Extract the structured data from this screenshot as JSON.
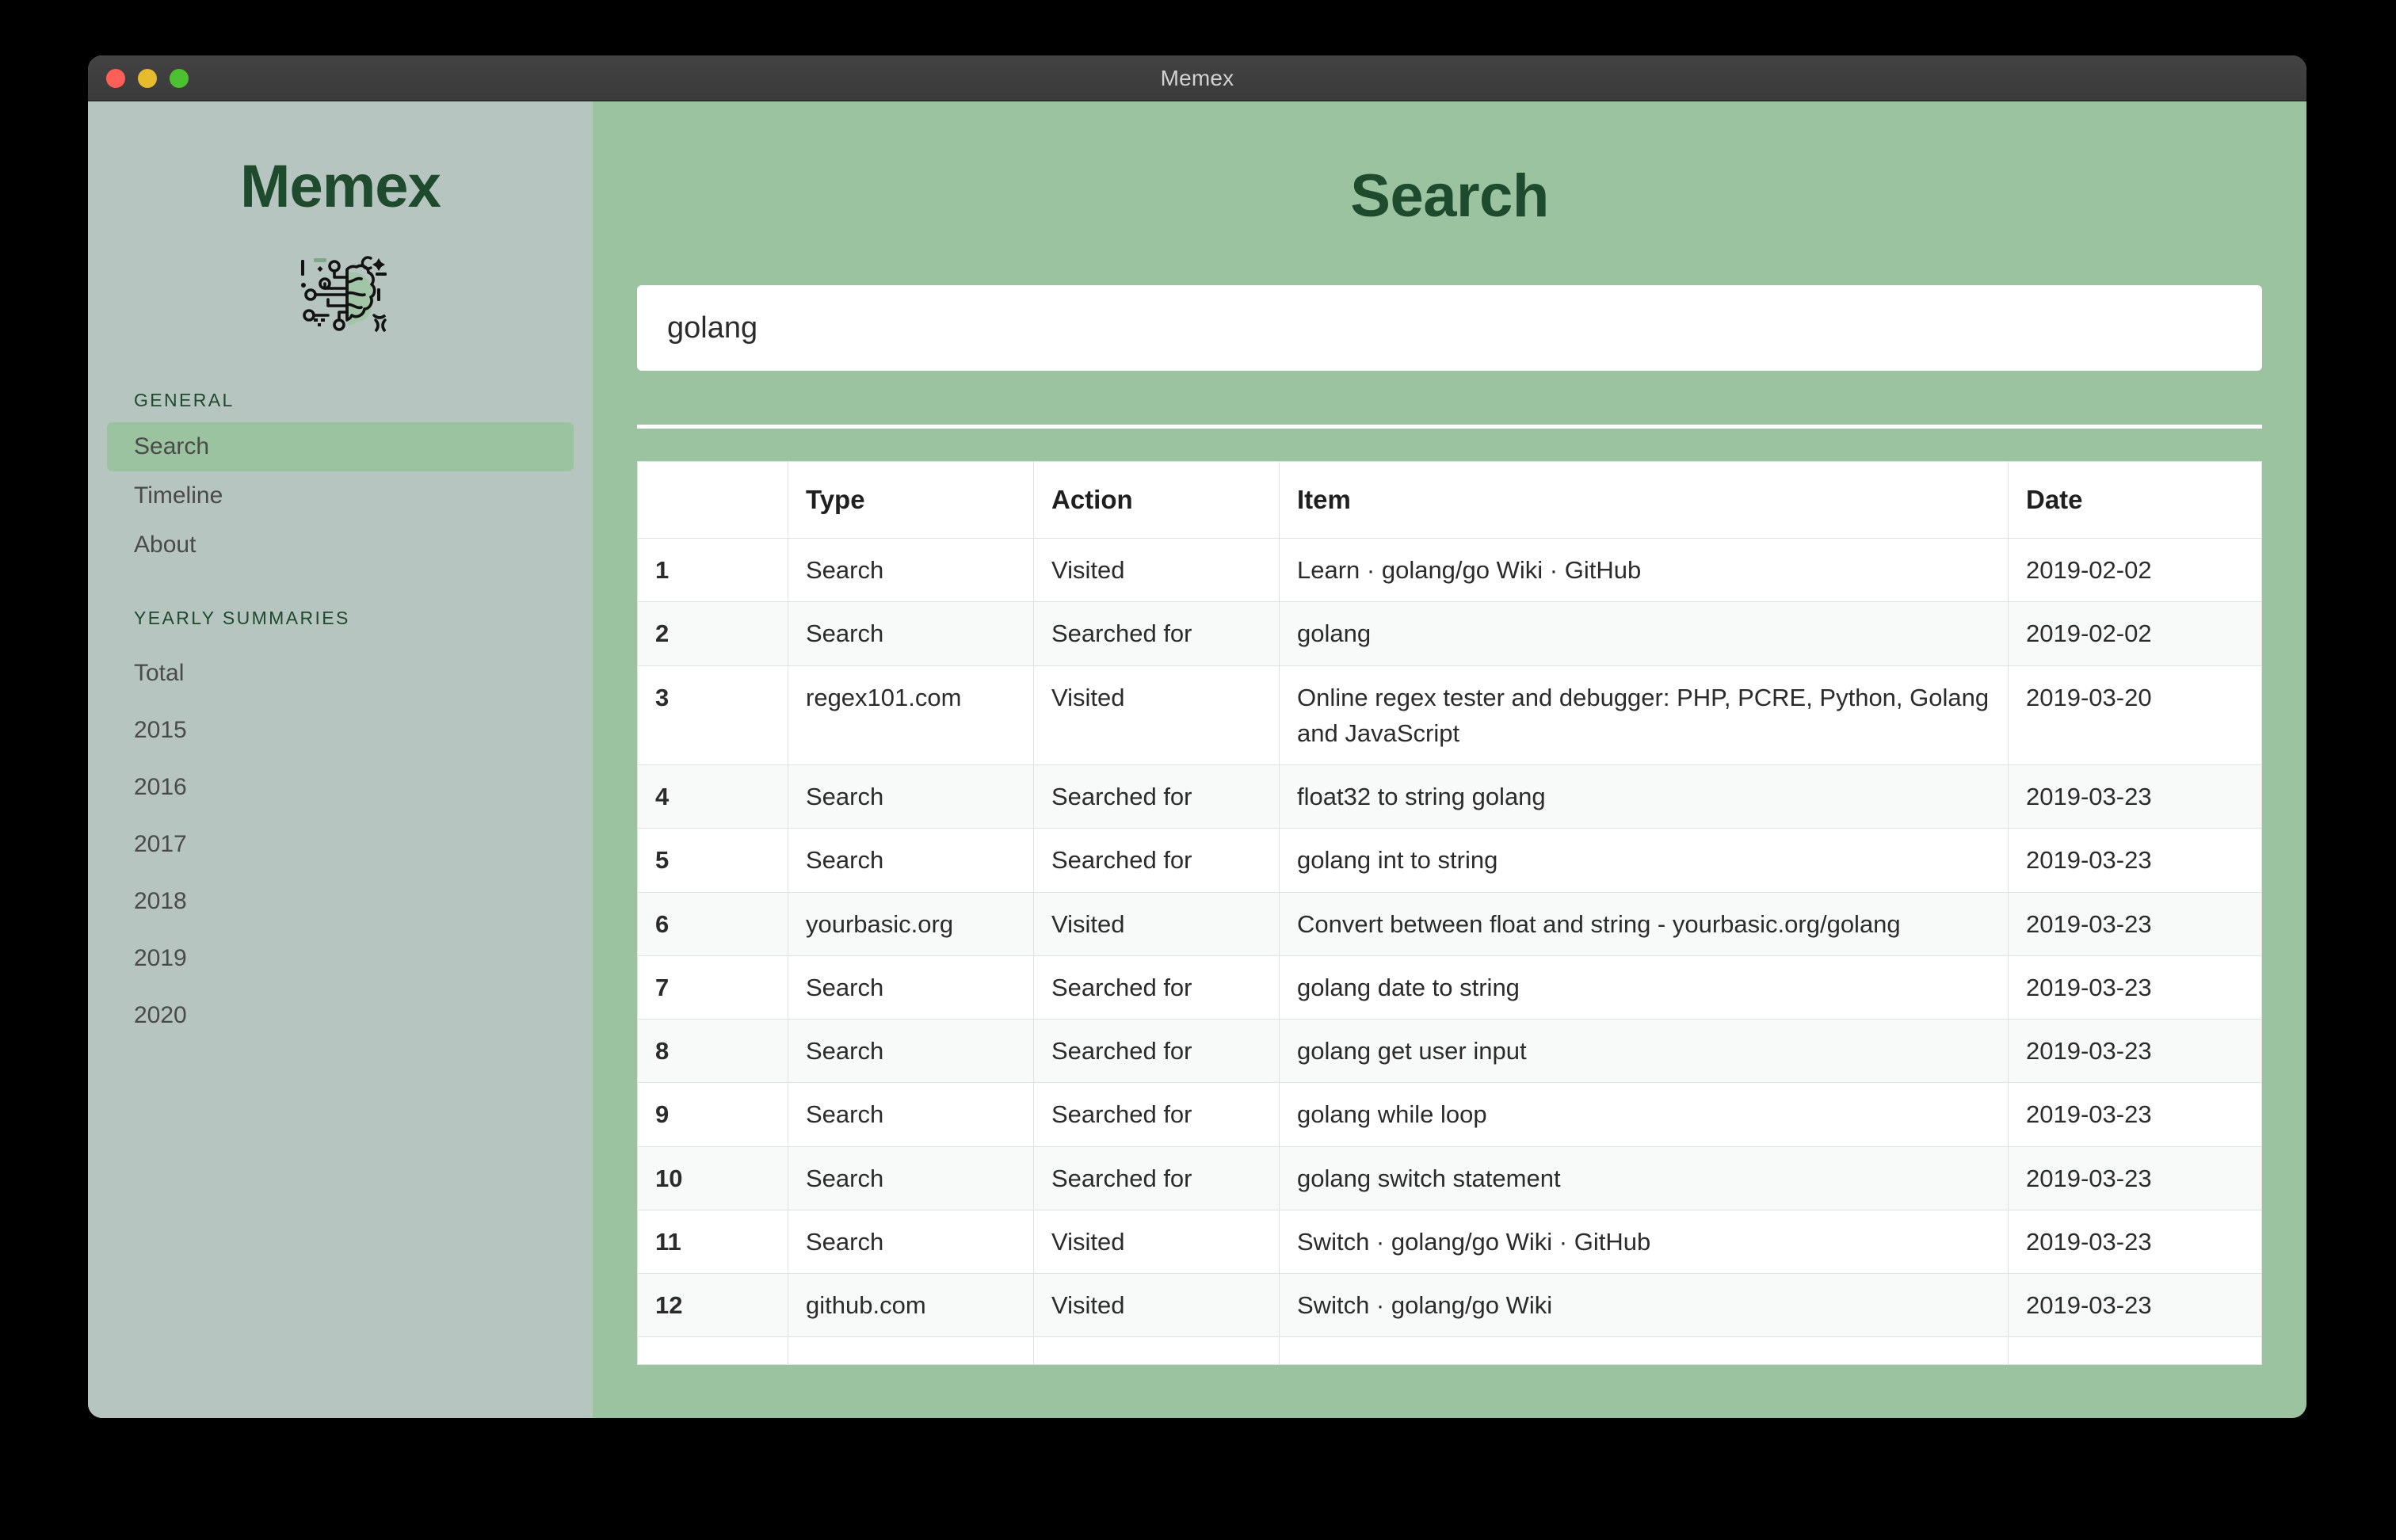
{
  "window": {
    "title": "Memex",
    "controls": [
      {
        "name": "close",
        "color": "#ff5f57"
      },
      {
        "name": "minimize",
        "color": "#e6bb2e"
      },
      {
        "name": "zoom",
        "color": "#4cc230"
      }
    ]
  },
  "theme": {
    "sidebar_bg": "#b6c5bf",
    "main_bg": "#9bc39f",
    "accent_dark_green": "#1e4a2e",
    "active_item_bg": "#9bc39f",
    "table_bg": "#ffffff",
    "table_stripe": "#f8f9f9",
    "table_border": "#e2e2e2"
  },
  "sidebar": {
    "brand": "Memex",
    "logo_icon": "ai-brain-circuit-icon",
    "sections": [
      {
        "heading": "GENERAL",
        "items": [
          {
            "label": "Search",
            "active": true
          },
          {
            "label": "Timeline",
            "active": false
          },
          {
            "label": "About",
            "active": false
          }
        ]
      },
      {
        "heading": "YEARLY SUMMARIES",
        "items": [
          {
            "label": "Total",
            "active": false
          },
          {
            "label": "2015",
            "active": false
          },
          {
            "label": "2016",
            "active": false
          },
          {
            "label": "2017",
            "active": false
          },
          {
            "label": "2018",
            "active": false
          },
          {
            "label": "2019",
            "active": false
          },
          {
            "label": "2020",
            "active": false
          }
        ]
      }
    ]
  },
  "main": {
    "title": "Search",
    "search": {
      "value": "golang",
      "placeholder": ""
    },
    "table": {
      "columns": [
        "",
        "Type",
        "Action",
        "Item",
        "Date"
      ],
      "rows": [
        {
          "index": "1",
          "type": "Search",
          "action": "Visited",
          "item": "Learn · golang/go Wiki · GitHub",
          "date": "2019-02-02"
        },
        {
          "index": "2",
          "type": "Search",
          "action": "Searched for",
          "item": "golang",
          "date": "2019-02-02"
        },
        {
          "index": "3",
          "type": "regex101.com",
          "action": "Visited",
          "item": "Online regex tester and debugger: PHP, PCRE, Python, Golang and JavaScript",
          "date": "2019-03-20"
        },
        {
          "index": "4",
          "type": "Search",
          "action": "Searched for",
          "item": "float32 to string golang",
          "date": "2019-03-23"
        },
        {
          "index": "5",
          "type": "Search",
          "action": "Searched for",
          "item": "golang int to string",
          "date": "2019-03-23"
        },
        {
          "index": "6",
          "type": "yourbasic.org",
          "action": "Visited",
          "item": "Convert between float and string - yourbasic.org/golang",
          "date": "2019-03-23"
        },
        {
          "index": "7",
          "type": "Search",
          "action": "Searched for",
          "item": "golang date to string",
          "date": "2019-03-23"
        },
        {
          "index": "8",
          "type": "Search",
          "action": "Searched for",
          "item": "golang get user input",
          "date": "2019-03-23"
        },
        {
          "index": "9",
          "type": "Search",
          "action": "Searched for",
          "item": "golang while loop",
          "date": "2019-03-23"
        },
        {
          "index": "10",
          "type": "Search",
          "action": "Searched for",
          "item": "golang switch statement",
          "date": "2019-03-23"
        },
        {
          "index": "11",
          "type": "Search",
          "action": "Visited",
          "item": "Switch · golang/go Wiki · GitHub",
          "date": "2019-03-23"
        },
        {
          "index": "12",
          "type": "github.com",
          "action": "Visited",
          "item": "Switch · golang/go Wiki",
          "date": "2019-03-23"
        },
        {
          "index": "",
          "type": "",
          "action": "",
          "item": "",
          "date": ""
        }
      ]
    }
  }
}
